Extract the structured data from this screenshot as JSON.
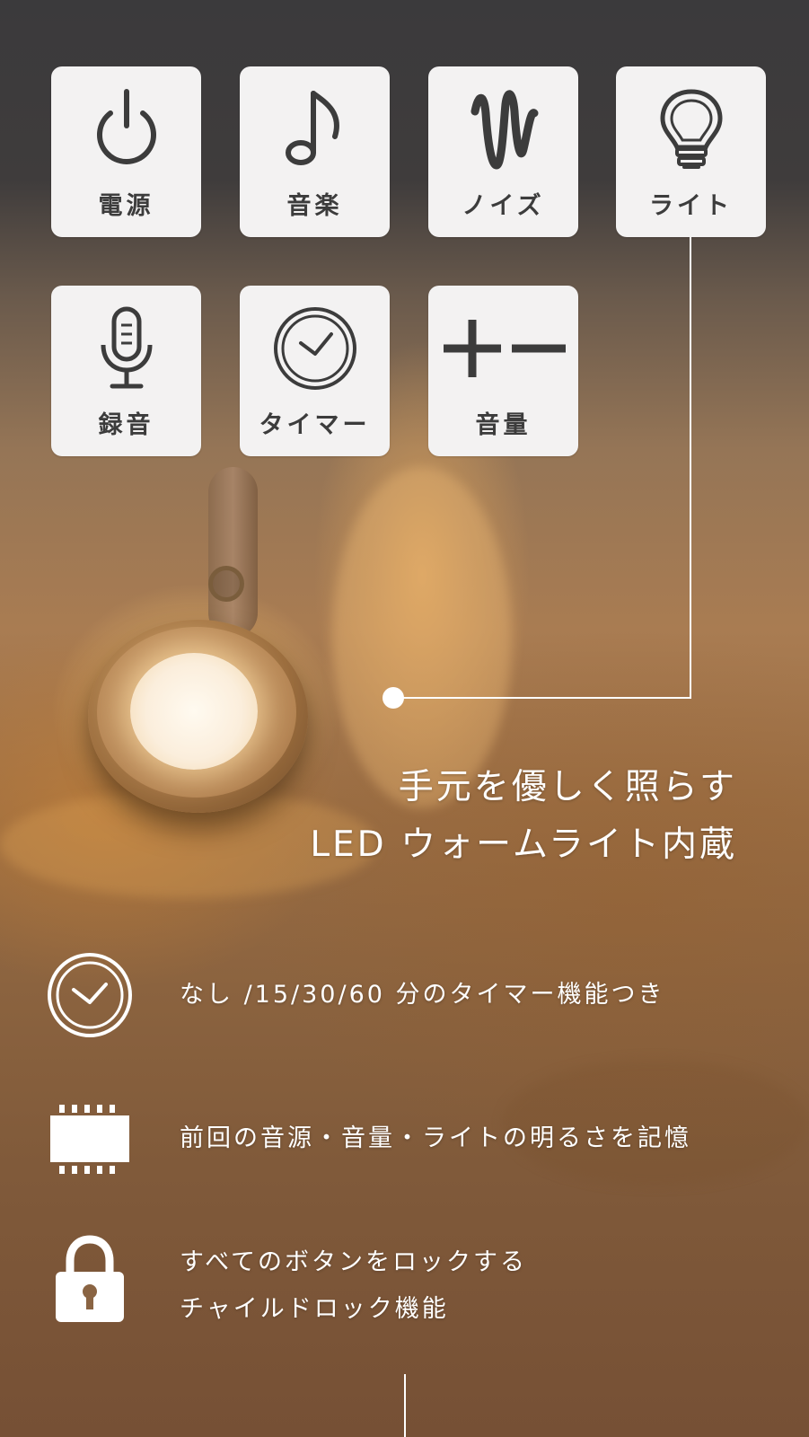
{
  "buttons": [
    {
      "label": "電源",
      "icon": "power-icon"
    },
    {
      "label": "音楽",
      "icon": "music-note-icon"
    },
    {
      "label": "ノイズ",
      "icon": "noise-wave-icon"
    },
    {
      "label": "ライト",
      "icon": "light-bulb-icon"
    },
    {
      "label": "録音",
      "icon": "microphone-icon"
    },
    {
      "label": "タイマー",
      "icon": "clock-icon"
    },
    {
      "label": "音量",
      "icon": "plus-minus-icon"
    }
  ],
  "headline": {
    "line1": "手元を優しく照らす",
    "line2": "LED ウォームライト内蔵"
  },
  "features": [
    {
      "icon": "clock-icon",
      "lines": [
        "なし /15/30/60 分のタイマー機能つき"
      ]
    },
    {
      "icon": "memory-chip-icon",
      "lines": [
        "前回の音源・音量・ライトの明るさを記憶"
      ]
    },
    {
      "icon": "lock-icon",
      "lines": [
        "すべてのボタンをロックする",
        "チャイルドロック機能"
      ]
    }
  ],
  "colors": {
    "tile_bg": "#f3f2f2",
    "icon_color": "#3c3c3c",
    "text_white": "#ffffff",
    "top_bg": "#3b3a3c"
  }
}
